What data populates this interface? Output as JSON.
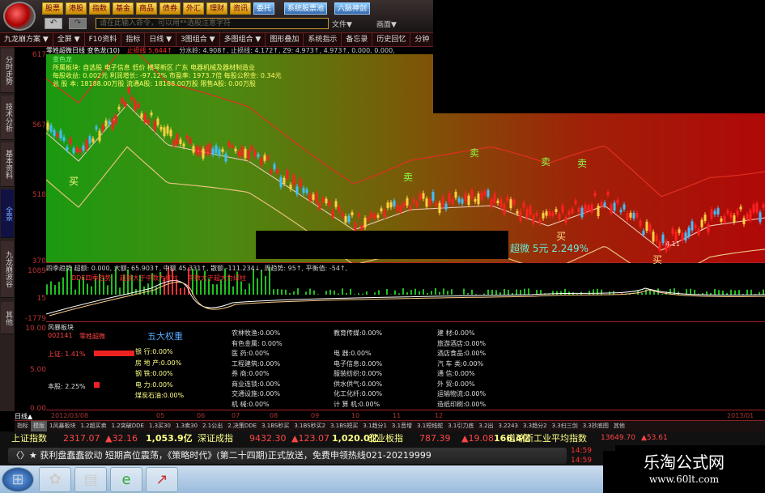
{
  "toolbar": {
    "buttons": [
      "股票",
      "港股",
      "指数",
      "基金",
      "商品",
      "债券",
      "外汇",
      "理财",
      "资讯"
    ],
    "blue_buttons": [
      "委托",
      "系统股票池",
      "六脉神剑"
    ],
    "search_placeholder": "请在此输入命令，可以用**选股注意字符",
    "file_menu": "文件▼",
    "view_menu": "画面▼"
  },
  "menu": [
    "九龙崩方案 ▼",
    "全屏 ▼",
    "F10资料",
    "指标",
    "日线 ▼",
    "3图组合 ▼",
    "多图组合 ▼",
    "图形叠加",
    "系统指示",
    "备忘录",
    "历史回忆",
    "分钟"
  ],
  "sidebar": [
    "分时走势",
    "技术分析",
    "基本资料",
    "全景",
    "九龙崩波谷",
    "其他"
  ],
  "axis": {
    "main": [
      "617",
      "567",
      "518",
      "370"
    ],
    "ind": [
      "1089",
      "15",
      "-1779"
    ],
    "sector": [
      "10.00",
      "5.00",
      "0.00"
    ]
  },
  "info_line": {
    "title": "零姓超微日线 变色龙(10)",
    "stop": "止损线 5.644↑",
    "values": "分水岭: 4.908↑, 止损线: 4.172↑, Z9: 4.973↑, 4.973↑, 0.000, 0.000,"
  },
  "stock_info": {
    "label": "变色龙",
    "sector": "所属板块: 自选股 电子信息 低价 横琴新区 广东 电器机械及器材制造业",
    "eps": "每股收益: 0.002元  利润增长: -97.12%  市盈率: 1973.7倍  每股公积金: 0.34元",
    "shares": "总 股 本: 18188.00万股 流通A股: 18188.00万股 限售A股: 0.00万股"
  },
  "signals": {
    "buy": "买",
    "sell": "卖",
    "low": "4.11"
  },
  "price_label": "超微 5元 2.249%",
  "indicator": {
    "header": "四季趋势 超额: 0.000, 大额: 65.903↑, 中额 45.331↑, 散额 -111.234↓, 周趋势: 95↑, 平衡值: -54↑,",
    "labels": [
      "DDE四季趋势",
      "超额大于中数为红柱",
      "中数大于超大为绿柱"
    ]
  },
  "sector": {
    "title": "风暴板块",
    "code": "002141",
    "name": "零姓超微",
    "weights_title": "五大权重",
    "sh": "上证: 1.41%",
    "stock": "本股: 2.25%",
    "weights": [
      "银    行:0.00%",
      "房 地 产:0.00%",
      "钢    铁:0.00%",
      "电    力:0.00%",
      "煤炭石油:0.00%"
    ],
    "col1": [
      "农林牧渔:0.00%",
      "有色金属: 0.00%",
      "医    药:0.00%",
      "工程建筑:0.00%",
      "券    商:0.00%",
      "商业连锁:0.00%",
      "交通设施:0.00%",
      "机    械:0.00%"
    ],
    "col2": [
      "教育传媒:0.00%",
      "",
      "电    器:0.00%",
      "电子信息:0.00%",
      "服装纺织:0.00%",
      "供水供气:0.00%",
      "化工化纤:0.00%",
      "计 算 机:0.00%"
    ],
    "col3": [
      "建    材:0.00%",
      "旅游酒店:0.00%",
      "酒店食品:0.00%",
      "汽 车 类:0.00%",
      "通    信:0.00%",
      "外    贸:0.00%",
      "运输物流:0.00%",
      "造纸印刷:0.00%"
    ]
  },
  "dates": [
    "日线▲",
    "2012/03/08",
    "05",
    "06",
    "07",
    "08",
    "09",
    "10",
    "11",
    "12",
    "2013/01"
  ],
  "tabs": [
    "指标",
    "模版",
    "1风暴板块",
    "1.2超买卖",
    "1.2突破DDE",
    "1.3买30",
    "1.3卖30",
    "2.1公出",
    "2.决策DDE",
    "3.1BS秒买",
    "3.1BS秒买2",
    "3.1BS短买",
    "3.1趋分1",
    "3.1音增",
    "3.1短线蛇",
    "3.1引力底",
    "3.2出",
    "3.2243",
    "3.3趋分2",
    "3.3扫三剑",
    "3.3抄底图",
    "其他"
  ],
  "index_bar": [
    {
      "name": "上证指数",
      "value": "2317.07",
      "change": "▲32.16",
      "vol": "1,053.9亿"
    },
    {
      "name": "深证成指",
      "value": "9432.30",
      "change": "▲123.07",
      "vol": "1,020.0亿"
    },
    {
      "name": "创业板指",
      "value": "787.39",
      "change": "▲19.08",
      "vol": "166.4亿"
    },
    {
      "name": "道琼斯工业平均指数",
      "value": "13649.70",
      "change": "▲53.61",
      "vol": ""
    }
  ],
  "news": "〈〉★ 获利盘蠢蠢欲动 短期高位震荡，《策略时代》(第二十四期)正式放送，免费申领热线021-20219999",
  "ticker_times": [
    "14:59",
    "14:59"
  ],
  "watermark": {
    "name": "乐淘公式网",
    "url": "www.60lt.com"
  },
  "colors": {
    "up": "#ff2020",
    "down": "#40c0ff",
    "ma": "#ffd040",
    "green_bar": "#20c020"
  }
}
